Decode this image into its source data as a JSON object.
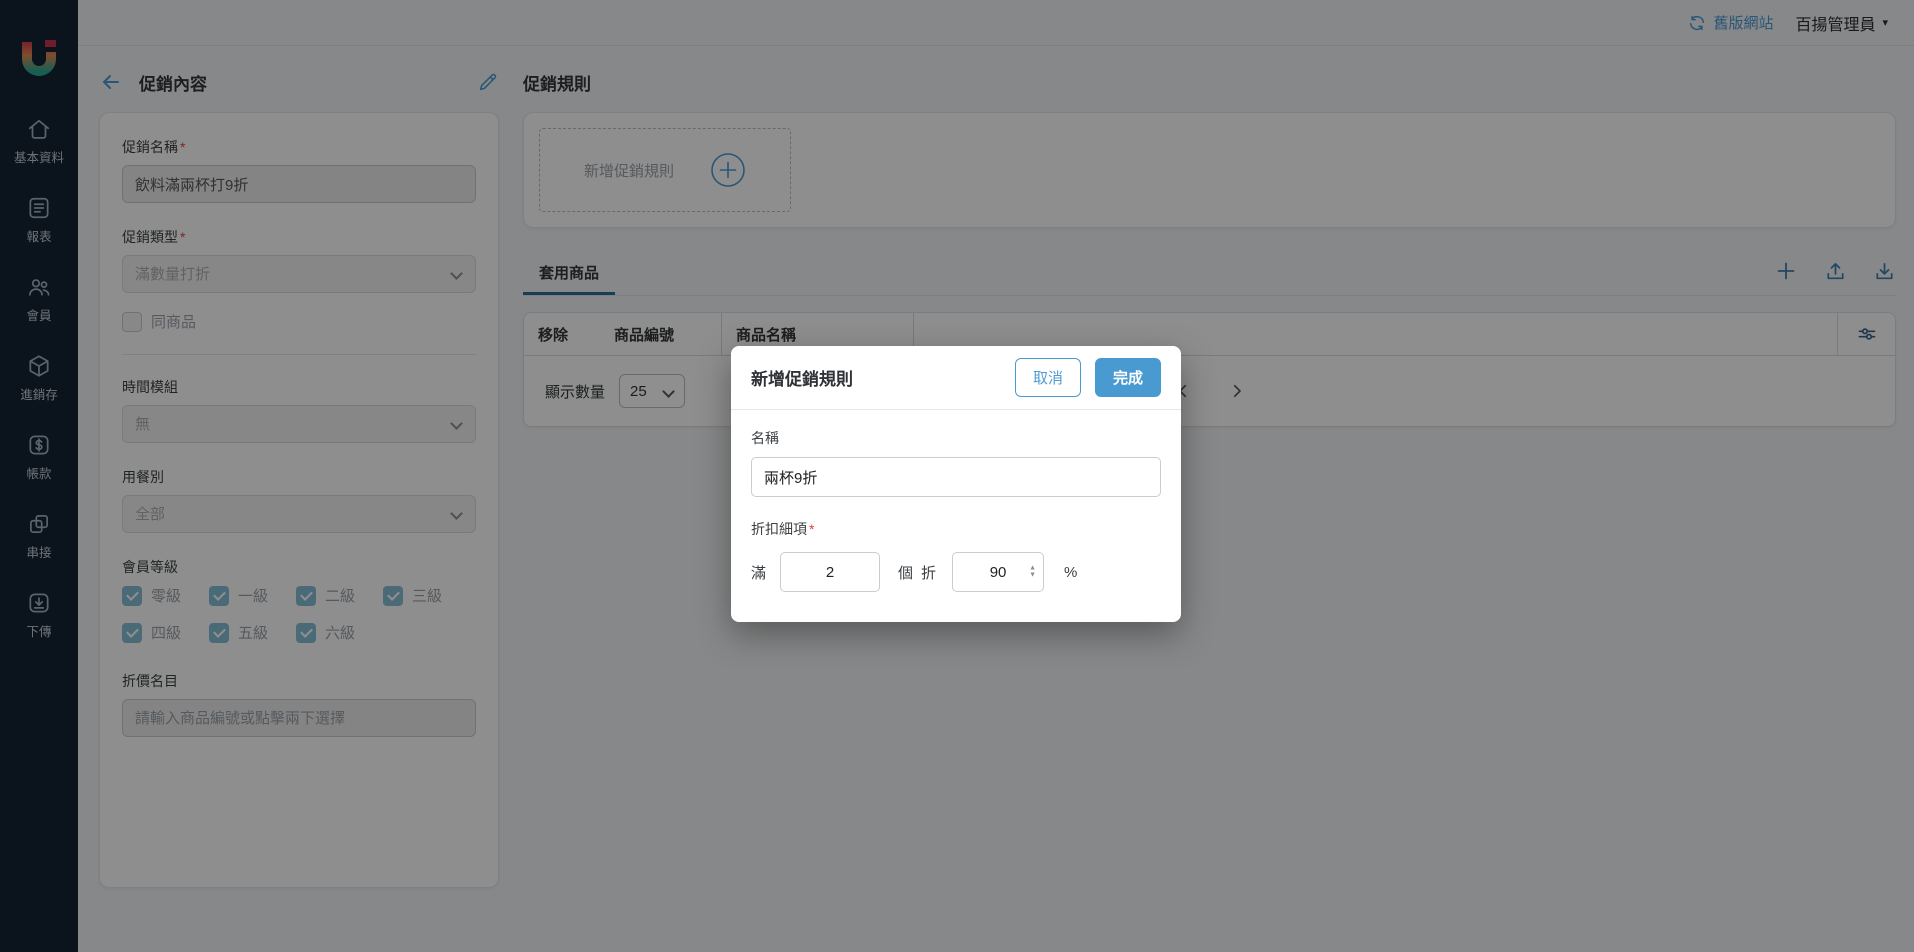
{
  "topbar": {
    "old_site_label": "舊版網站",
    "admin_label": "百揚管理員",
    "caret": "▾"
  },
  "sidebar": {
    "items": [
      {
        "label": "基本資料",
        "icon": "home-icon"
      },
      {
        "label": "報表",
        "icon": "report-icon"
      },
      {
        "label": "會員",
        "icon": "members-icon"
      },
      {
        "label": "進銷存",
        "icon": "inventory-icon"
      },
      {
        "label": "帳款",
        "icon": "billing-icon"
      },
      {
        "label": "串接",
        "icon": "integration-icon"
      },
      {
        "label": "下傳",
        "icon": "download-icon"
      }
    ]
  },
  "promo_panel": {
    "title": "促銷內容",
    "required_mark": "*",
    "name_label": "促銷名稱",
    "name_value": "飲料滿兩杯打9折",
    "type_label": "促銷類型",
    "type_value": "滿數量打折",
    "same_product_label": "同商品",
    "time_module_label": "時間模組",
    "time_module_value": "無",
    "meal_type_label": "用餐別",
    "meal_type_value": "全部",
    "member_level_label": "會員等級",
    "member_levels": [
      "零級",
      "一級",
      "二級",
      "三級",
      "四級",
      "五級",
      "六級"
    ],
    "discount_name_label": "折價名目",
    "discount_name_placeholder": "請輸入商品編號或點擊兩下選擇"
  },
  "rules": {
    "title": "促銷規則",
    "add_button_label": "新增促銷規則"
  },
  "products": {
    "tab_label": "套用商品",
    "columns": [
      "移除",
      "商品編號",
      "商品名稱"
    ],
    "display_count_label": "顯示數量",
    "display_count_value": "25"
  },
  "modal": {
    "title": "新增促銷規則",
    "cancel_label": "取消",
    "done_label": "完成",
    "name_label": "名稱",
    "name_value": "兩杯9折",
    "detail_label": "折扣細項",
    "required_mark": "*",
    "qty_prefix": "滿",
    "qty_value": "2",
    "qty_unit": "個",
    "discount_prefix": "折",
    "discount_value": "90",
    "percent_label": "%"
  },
  "colors": {
    "accent_blue": "#4a9ad2",
    "sidebar_bg": "#152433",
    "tab_underline": "#2e6e96",
    "required_red": "#e03e3e",
    "checkbox_checked": "#85bed7",
    "overlay": "rgba(0,0,0,0.44)"
  }
}
